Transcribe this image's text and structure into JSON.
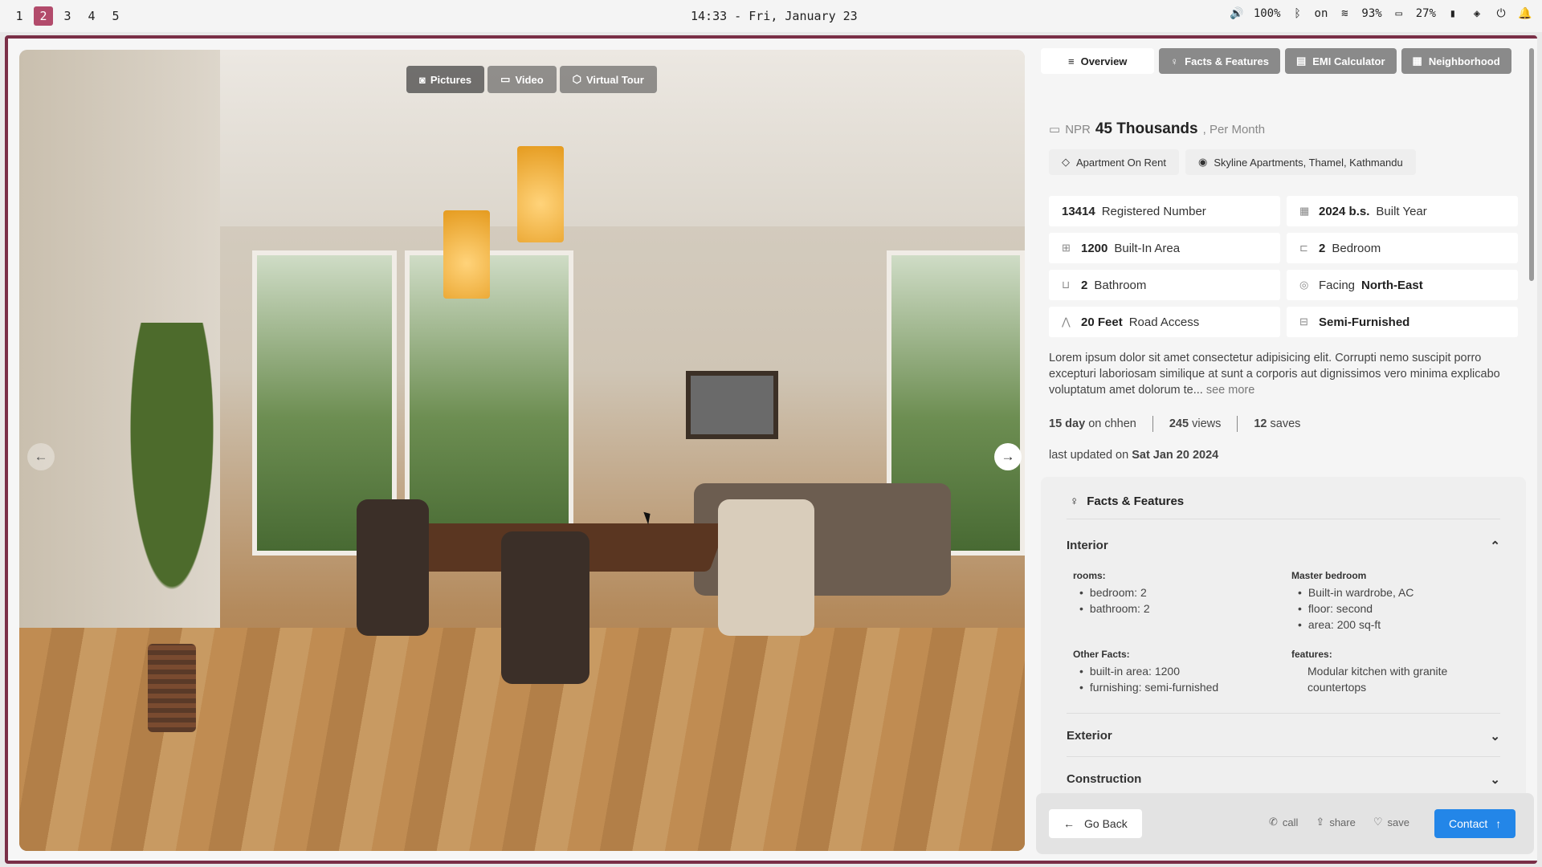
{
  "system": {
    "workspaces": [
      "1",
      "2",
      "3",
      "4",
      "5"
    ],
    "active_workspace": "2",
    "clock": "14:33 - Fri, January 23",
    "volume": "100%",
    "bluetooth": "on",
    "wifi": "93%",
    "battery": "27%"
  },
  "media": {
    "tabs": [
      {
        "label": "Pictures",
        "icon": "camera-icon"
      },
      {
        "label": "Video",
        "icon": "video-icon"
      },
      {
        "label": "Virtual Tour",
        "icon": "cube-icon"
      }
    ]
  },
  "nav": {
    "tabs": [
      {
        "label": "Overview",
        "icon": "list-icon"
      },
      {
        "label": "Facts & Features",
        "icon": "bulb-icon"
      },
      {
        "label": "EMI Calculator",
        "icon": "calculator-icon"
      },
      {
        "label": "Neighborhood",
        "icon": "building-icon"
      }
    ]
  },
  "listing": {
    "currency": "NPR",
    "amount": "45 Thousands",
    "period": ", Per Month",
    "type": "Apartment On Rent",
    "location": "Skyline Apartments, Thamel, Kathmandu",
    "details": [
      {
        "value": "13414",
        "label": "Registered Number",
        "icon": ""
      },
      {
        "value": "2024 b.s.",
        "label": "Built Year",
        "icon": "building-icon"
      },
      {
        "value": "1200",
        "label": "Built-In Area",
        "icon": "area-icon"
      },
      {
        "value": "2",
        "label": "Bedroom",
        "icon": "bed-icon"
      },
      {
        "value": "2",
        "label": "Bathroom",
        "icon": "bath-icon"
      },
      {
        "value": "North-East",
        "label": "Facing",
        "icon": "compass-icon"
      },
      {
        "value": "20 Feet",
        "label": "Road Access",
        "icon": "road-icon"
      },
      {
        "value": "Semi-Furnished",
        "label": "",
        "icon": "sofa-icon"
      }
    ],
    "description": "Lorem ipsum dolor sit amet consectetur adipisicing elit. Corrupti nemo suscipit porro excepturi laboriosam similique at sunt a corporis aut dignissimos vero minima explicabo voluptatum amet dolorum te...",
    "see_more": "see more",
    "days": "15 day",
    "days_suffix": "on chhen",
    "views": "245",
    "views_suffix": "views",
    "saves": "12",
    "saves_suffix": "saves",
    "updated_prefix": "last updated on",
    "updated_date": "Sat Jan 20 2024"
  },
  "facts": {
    "title": "Facts & Features",
    "interior": "Interior",
    "rooms_title": "rooms:",
    "rooms": [
      "bedroom: 2",
      "bathroom: 2"
    ],
    "master_title": "Master bedroom",
    "master": [
      "Built-in wardrobe, AC",
      "floor: second",
      "area: 200 sq-ft"
    ],
    "other_title": "Other Facts:",
    "other": [
      "built-in area: 1200",
      "furnishing: semi-furnished"
    ],
    "features_title": "features:",
    "features_text": "Modular kitchen with granite countertops",
    "exterior": "Exterior",
    "construction": "Construction"
  },
  "actions": {
    "go_back": "Go Back",
    "call": "call",
    "share": "share",
    "save": "save",
    "contact": "Contact"
  }
}
